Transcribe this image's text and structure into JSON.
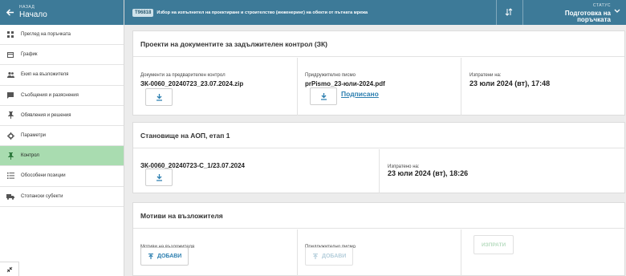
{
  "sidebar": {
    "back_label": "НАЗАД",
    "home_label": "Начало",
    "items": [
      {
        "label": "Преглед на поръчката",
        "icon": "grid-icon",
        "active": false
      },
      {
        "label": "График",
        "icon": "calendar-icon",
        "active": false
      },
      {
        "label": "Екип на възложителя",
        "icon": "team-icon",
        "active": false
      },
      {
        "label": "Съобщения и разяснения",
        "icon": "message-icon",
        "active": false
      },
      {
        "label": "Обявления и решения",
        "icon": "pin-icon",
        "active": false
      },
      {
        "label": "Параметри",
        "icon": "gear-icon",
        "active": false
      },
      {
        "label": "Контрол",
        "icon": "pin-icon",
        "active": true
      },
      {
        "label": "Обособени позиции",
        "icon": "list-icon",
        "active": false
      },
      {
        "label": "Стопански субекти",
        "icon": "truck-icon",
        "active": false
      }
    ],
    "collapse_icon": "collapse-icon"
  },
  "topbar": {
    "badge": "Т96818",
    "title": "Избор на изпълнител на проектиране и строителство (инженеринг) на обекти от пътната мрежа",
    "status_label": "СТАТУС",
    "status_value": "Подготовка на поръчката",
    "colors": {
      "bar": "#3d7a98"
    }
  },
  "card1": {
    "title": "Проекти на документите за задължителен контрол (ЗК)",
    "col1_label": "Документи за предварителен контрол",
    "col1_file": "ЗК-0060_20240723_23.07.2024.zip",
    "col2_label": "Придружително писмо",
    "col2_file": "prPismo_23-юли-2024.pdf",
    "col2_link": "Подписано",
    "col3_label": "Изпратени на:",
    "col3_date": "23 юли 2024 (вт), 17:48"
  },
  "card2": {
    "title": "Становище на АОП, етап 1",
    "col1_file": "ЗК-0060_20240723-С_1/23.07.2024",
    "col2_label": "Изпратено на:",
    "col2_date": "23 юли 2024 (вт), 18:26"
  },
  "card3": {
    "title": "Мотиви на възложителя",
    "col1_label": "Мотиви на възложителя",
    "col1_button": "ДОБАВИ",
    "col2_label": "Придружително писмо",
    "col2_button": "ДОБАВИ",
    "send_button": "ИЗПРАТИ"
  }
}
